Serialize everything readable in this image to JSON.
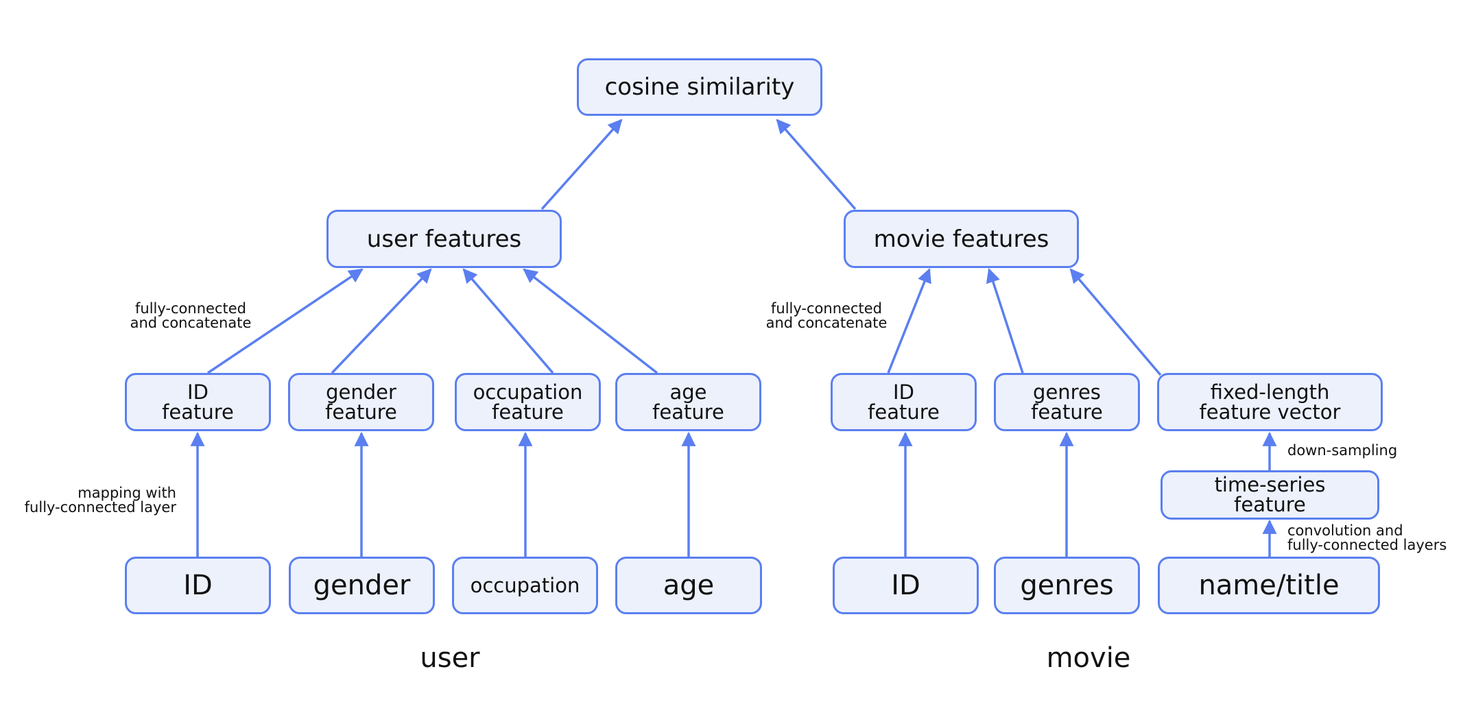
{
  "title": "cosine similarity",
  "nodes": {
    "cosine": "cosine similarity",
    "user_features": "user features",
    "movie_features": "movie features",
    "user_id_feature": "ID\nfeature",
    "gender_feature": "gender\nfeature",
    "occupation_feature": "occupation\nfeature",
    "age_feature": "age\nfeature",
    "movie_id_feature": "ID\nfeature",
    "genres_feature": "genres\nfeature",
    "fixed_length": "fixed-length\nfeature vector",
    "time_series": "time-series\nfeature",
    "user_id": "ID",
    "gender": "gender",
    "occupation": "occupation",
    "age": "age",
    "movie_id": "ID",
    "genres": "genres",
    "name_title": "name/title"
  },
  "annotations": {
    "user_concat": "fully-connected\nand concatenate",
    "movie_concat": "fully-connected\nand concatenate",
    "mapping": "mapping with\nfully-connected layer",
    "down_sampling": "down-sampling",
    "conv": "convolution and\nfully-connected layers"
  },
  "groups": {
    "user": "user",
    "movie": "movie"
  },
  "colors": {
    "accent": "#5b7ff0",
    "node_fill": "#ecf1fc"
  },
  "edges": [
    {
      "from": "user_features",
      "to": "cosine"
    },
    {
      "from": "movie_features",
      "to": "cosine"
    },
    {
      "from": "user_id_feature",
      "to": "user_features"
    },
    {
      "from": "gender_feature",
      "to": "user_features"
    },
    {
      "from": "occupation_feature",
      "to": "user_features"
    },
    {
      "from": "age_feature",
      "to": "user_features"
    },
    {
      "from": "movie_id_feature",
      "to": "movie_features"
    },
    {
      "from": "genres_feature",
      "to": "movie_features"
    },
    {
      "from": "fixed_length",
      "to": "movie_features"
    },
    {
      "from": "user_id",
      "to": "user_id_feature"
    },
    {
      "from": "gender",
      "to": "gender_feature"
    },
    {
      "from": "occupation",
      "to": "occupation_feature"
    },
    {
      "from": "age",
      "to": "age_feature"
    },
    {
      "from": "movie_id",
      "to": "movie_id_feature"
    },
    {
      "from": "genres",
      "to": "genres_feature"
    },
    {
      "from": "time_series",
      "to": "fixed_length"
    },
    {
      "from": "name_title",
      "to": "time_series"
    }
  ]
}
